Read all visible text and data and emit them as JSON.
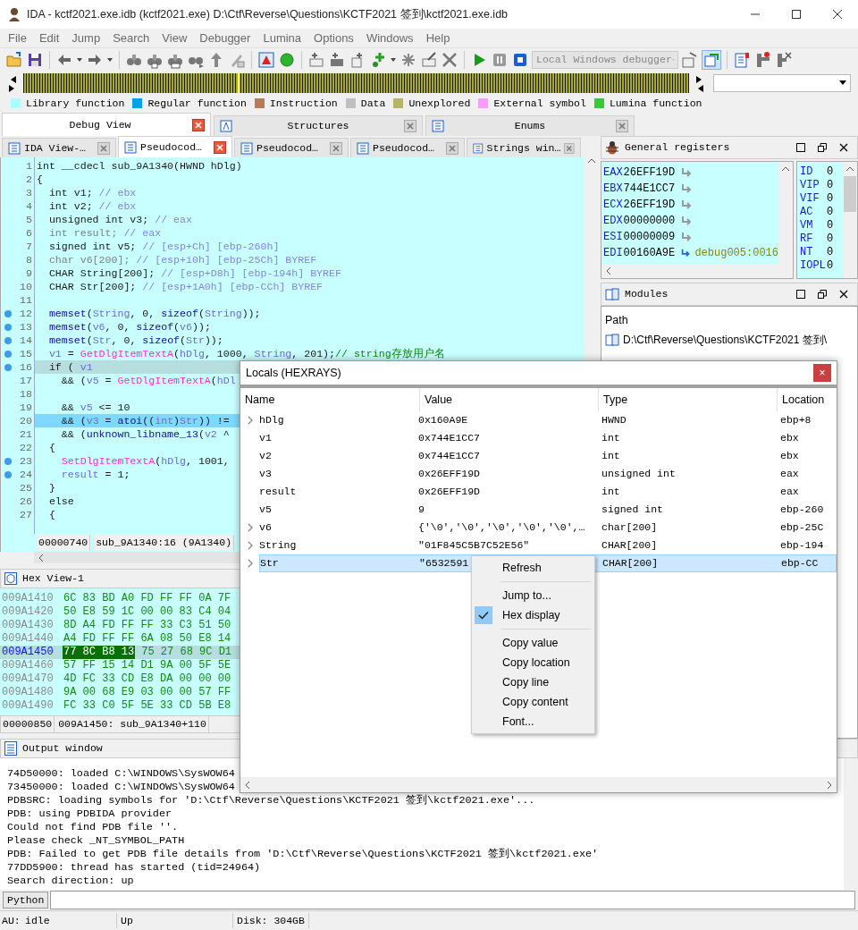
{
  "window": {
    "title": "IDA - kctf2021.exe.idb (kctf2021.exe) D:\\Ctf\\Reverse\\Questions\\KCTF2021 签到\\kctf2021.exe.idb"
  },
  "menu": [
    "File",
    "Edit",
    "Jump",
    "Search",
    "View",
    "Debugger",
    "Lumina",
    "Options",
    "Windows",
    "Help"
  ],
  "toolbar": {
    "debugger": "Local Windows debugger"
  },
  "legend": [
    {
      "label": "Library function",
      "color": "#aaffff"
    },
    {
      "label": "Regular function",
      "color": "#00a2e8"
    },
    {
      "label": "Instruction",
      "color": "#b97a57"
    },
    {
      "label": "Data",
      "color": "#c0c0c0"
    },
    {
      "label": "Unexplored",
      "color": "#b5b56a"
    },
    {
      "label": "External symbol",
      "color": "#ff99ff"
    },
    {
      "label": "Lumina function",
      "color": "#33cc33"
    }
  ],
  "top_tabs": [
    {
      "label": "Debug View",
      "selected": true
    },
    {
      "label": "Structures",
      "selected": false
    },
    {
      "label": "Enums",
      "selected": false
    }
  ],
  "view_tabs": [
    {
      "label": "IDA View-…",
      "selected": false
    },
    {
      "label": "Pseudocod…",
      "selected": true
    },
    {
      "label": "Pseudocod…",
      "selected": false
    },
    {
      "label": "Pseudocod…",
      "selected": false
    },
    {
      "label": "Strings win…",
      "selected": false
    }
  ],
  "pseudocode": {
    "lines": [
      {
        "n": "1",
        "dot": false,
        "current": false,
        "selected": false,
        "segments": [
          {
            "kind": "plain",
            "text": "int __cdecl sub_9A1340(HWND hDlg)"
          }
        ]
      },
      {
        "n": "2",
        "dot": false,
        "current": false,
        "selected": false,
        "segments": [
          {
            "kind": "plain",
            "text": "{"
          }
        ]
      },
      {
        "n": "3",
        "dot": false,
        "current": false,
        "selected": false,
        "segments": [
          {
            "kind": "plain",
            "text": "  int v1; "
          },
          {
            "kind": "comment",
            "text": "// ebx"
          }
        ]
      },
      {
        "n": "4",
        "dot": false,
        "current": false,
        "selected": false,
        "segments": [
          {
            "kind": "plain",
            "text": "  int v2; "
          },
          {
            "kind": "comment",
            "text": "// ebx"
          }
        ]
      },
      {
        "n": "5",
        "dot": false,
        "current": false,
        "selected": false,
        "segments": [
          {
            "kind": "plain",
            "text": "  unsigned int v3; "
          },
          {
            "kind": "comment",
            "text": "// eax"
          }
        ]
      },
      {
        "n": "6",
        "dot": false,
        "current": false,
        "selected": false,
        "segments": [
          {
            "kind": "dim",
            "text": "  int result; "
          },
          {
            "kind": "comment",
            "text": "// eax"
          }
        ]
      },
      {
        "n": "7",
        "dot": false,
        "current": false,
        "selected": false,
        "segments": [
          {
            "kind": "plain",
            "text": "  signed int v5; "
          },
          {
            "kind": "comment",
            "text": "// [esp+Ch] [ebp-260h]"
          }
        ]
      },
      {
        "n": "8",
        "dot": false,
        "current": false,
        "selected": false,
        "segments": [
          {
            "kind": "dim",
            "text": "  char v6[200]; "
          },
          {
            "kind": "comment",
            "text": "// [esp+10h] [ebp-25Ch] BYREF"
          }
        ]
      },
      {
        "n": "9",
        "dot": false,
        "current": false,
        "selected": false,
        "segments": [
          {
            "kind": "plain",
            "text": "  CHAR String[200]; "
          },
          {
            "kind": "comment",
            "text": "// [esp+D8h] [ebp-194h] BYREF"
          }
        ]
      },
      {
        "n": "10",
        "dot": false,
        "current": false,
        "selected": false,
        "segments": [
          {
            "kind": "plain",
            "text": "  CHAR Str[200]; "
          },
          {
            "kind": "comment",
            "text": "// [esp+1A0h] [ebp-CCh] BYREF"
          }
        ]
      },
      {
        "n": "11",
        "dot": false,
        "current": false,
        "selected": false
      },
      {
        "n": "12",
        "dot": true,
        "current": false,
        "selected": false,
        "segments": [
          {
            "kind": "lib",
            "text": "  memset"
          },
          {
            "kind": "plain",
            "text": "("
          },
          {
            "kind": "var",
            "text": "String"
          },
          {
            "kind": "plain",
            "text": ", 0, "
          },
          {
            "kind": "lib",
            "text": "sizeof"
          },
          {
            "kind": "plain",
            "text": "("
          },
          {
            "kind": "var",
            "text": "String"
          },
          {
            "kind": "plain",
            "text": "));"
          }
        ]
      },
      {
        "n": "13",
        "dot": true,
        "current": false,
        "selected": false,
        "segments": [
          {
            "kind": "lib",
            "text": "  memset"
          },
          {
            "kind": "plain",
            "text": "("
          },
          {
            "kind": "var",
            "text": "v6"
          },
          {
            "kind": "plain",
            "text": ", 0, "
          },
          {
            "kind": "lib",
            "text": "sizeof"
          },
          {
            "kind": "plain",
            "text": "("
          },
          {
            "kind": "var",
            "text": "v6"
          },
          {
            "kind": "plain",
            "text": "));"
          }
        ]
      },
      {
        "n": "14",
        "dot": true,
        "current": false,
        "selected": false,
        "segments": [
          {
            "kind": "lib",
            "text": "  memset"
          },
          {
            "kind": "plain",
            "text": "("
          },
          {
            "kind": "var",
            "text": "Str"
          },
          {
            "kind": "plain",
            "text": ", 0, "
          },
          {
            "kind": "lib",
            "text": "sizeof"
          },
          {
            "kind": "plain",
            "text": "("
          },
          {
            "kind": "var",
            "text": "Str"
          },
          {
            "kind": "plain",
            "text": "));"
          }
        ]
      },
      {
        "n": "15",
        "dot": true,
        "current": false,
        "selected": false,
        "segments": [
          {
            "kind": "var",
            "text": "  v1"
          },
          {
            "kind": "plain",
            "text": " = "
          },
          {
            "kind": "func",
            "text": "GetDlgItemTextA"
          },
          {
            "kind": "plain",
            "text": "("
          },
          {
            "kind": "var",
            "text": "hDlg"
          },
          {
            "kind": "plain",
            "text": ", 1000, "
          },
          {
            "kind": "var",
            "text": "String"
          },
          {
            "kind": "plain",
            "text": ", 201);"
          },
          {
            "kind": "note",
            "text": "// string存放用户名"
          }
        ]
      },
      {
        "n": "16",
        "dot": true,
        "current": true,
        "selected": false,
        "segments": [
          {
            "kind": "plain",
            "text": "  if ( "
          },
          {
            "kind": "var",
            "text": "v1"
          }
        ]
      },
      {
        "n": "17",
        "dot": false,
        "current": false,
        "selected": false,
        "segments": [
          {
            "kind": "plain",
            "text": "    && ("
          },
          {
            "kind": "var",
            "text": "v5"
          },
          {
            "kind": "plain",
            "text": " = "
          },
          {
            "kind": "func",
            "text": "GetDlgItemTextA"
          },
          {
            "kind": "plain",
            "text": "("
          },
          {
            "kind": "var",
            "text": "hDl"
          }
        ]
      },
      {
        "n": "18",
        "dot": false,
        "current": false,
        "selected": false
      },
      {
        "n": "19",
        "dot": false,
        "current": false,
        "selected": false,
        "segments": [
          {
            "kind": "plain",
            "text": "    && "
          },
          {
            "kind": "var",
            "text": "v5"
          },
          {
            "kind": "plain",
            "text": " <= 10"
          }
        ]
      },
      {
        "n": "20",
        "dot": false,
        "current": false,
        "selected": true,
        "segments": [
          {
            "kind": "plain",
            "text": "    && ("
          },
          {
            "kind": "var",
            "text": "v3"
          },
          {
            "kind": "plain",
            "text": " = "
          },
          {
            "kind": "lib",
            "text": "atoi"
          },
          {
            "kind": "plain",
            "text": "(("
          },
          {
            "kind": "var",
            "text": "int"
          },
          {
            "kind": "plain",
            "text": ")"
          },
          {
            "kind": "var",
            "text": "Str"
          },
          {
            "kind": "plain",
            "text": ")) !="
          }
        ]
      },
      {
        "n": "21",
        "dot": false,
        "current": false,
        "selected": false,
        "segments": [
          {
            "kind": "plain",
            "text": "    && ("
          },
          {
            "kind": "lib",
            "text": "unknown_libname_13"
          },
          {
            "kind": "plain",
            "text": "("
          },
          {
            "kind": "var",
            "text": "v2"
          },
          {
            "kind": "plain",
            "text": " ^"
          }
        ]
      },
      {
        "n": "22",
        "dot": false,
        "current": false,
        "selected": false,
        "segments": [
          {
            "kind": "plain",
            "text": "  {"
          }
        ]
      },
      {
        "n": "23",
        "dot": true,
        "current": false,
        "selected": false,
        "segments": [
          {
            "kind": "func",
            "text": "    SetDlgItemTextA"
          },
          {
            "kind": "plain",
            "text": "("
          },
          {
            "kind": "var",
            "text": "hDlg"
          },
          {
            "kind": "plain",
            "text": ", 1001,"
          }
        ]
      },
      {
        "n": "24",
        "dot": true,
        "current": false,
        "selected": false,
        "segments": [
          {
            "kind": "var",
            "text": "    result"
          },
          {
            "kind": "plain",
            "text": " = 1;"
          }
        ]
      },
      {
        "n": "25",
        "dot": false,
        "current": false,
        "selected": false,
        "segments": [
          {
            "kind": "plain",
            "text": "  }"
          }
        ]
      },
      {
        "n": "26",
        "dot": false,
        "current": false,
        "selected": false,
        "segments": [
          {
            "kind": "plain",
            "text": "  else"
          }
        ]
      },
      {
        "n": "27",
        "dot": false,
        "current": false,
        "selected": false,
        "segments": [
          {
            "kind": "plain",
            "text": "  {"
          }
        ]
      }
    ],
    "status": [
      "00000740",
      "sub_9A1340:16 (9A1340)"
    ]
  },
  "registers": {
    "title": "General registers",
    "items": [
      {
        "name": "EAX",
        "value": "26EFF19D",
        "pointer": false
      },
      {
        "name": "EBX",
        "value": "744E1CC7",
        "pointer": false
      },
      {
        "name": "ECX",
        "value": "26EFF19D",
        "pointer": false
      },
      {
        "name": "EDX",
        "value": "00000000",
        "pointer": false
      },
      {
        "name": "ESI",
        "value": "00000009",
        "pointer": false
      },
      {
        "name": "EDI",
        "value": "00160A9E",
        "pointer": true,
        "target": "debug005:0016"
      }
    ],
    "flags": [
      {
        "name": "ID",
        "value": "0"
      },
      {
        "name": "VIP",
        "value": "0"
      },
      {
        "name": "VIF",
        "value": "0"
      },
      {
        "name": "AC",
        "value": "0"
      },
      {
        "name": "VM",
        "value": "0"
      },
      {
        "name": "RF",
        "value": "0"
      },
      {
        "name": "NT",
        "value": "0"
      },
      {
        "name": "IOPL",
        "value": "0"
      }
    ]
  },
  "modules": {
    "title": "Modules",
    "column": "Path",
    "rows": [
      "D:\\Ctf\\Reverse\\Questions\\KCTF2021 签到\\"
    ]
  },
  "hex_view": {
    "title": "Hex View-1",
    "rows": [
      {
        "addr": "009A1410",
        "current": false,
        "bytes": [
          "6C",
          "83",
          "BD",
          "A0",
          "FD",
          "FF",
          "FF",
          "0A",
          "7F"
        ]
      },
      {
        "addr": "009A1420",
        "current": false,
        "bytes": [
          "50",
          "E8",
          "59",
          "1C",
          "00",
          "00",
          "83",
          "C4",
          "04"
        ]
      },
      {
        "addr": "009A1430",
        "current": false,
        "bytes": [
          "8D",
          "A4",
          "FD",
          "FF",
          "FF",
          "33",
          "C3",
          "51",
          "50"
        ]
      },
      {
        "addr": "009A1440",
        "current": false,
        "bytes": [
          "A4",
          "FD",
          "FF",
          "FF",
          "6A",
          "08",
          "50",
          "E8",
          "14"
        ]
      },
      {
        "addr": "009A1450",
        "current": true,
        "selected_bytes": [
          "77",
          "8C",
          "B8",
          "13"
        ],
        "bytes": [
          "75",
          "27",
          "68",
          "9C",
          "D1"
        ]
      },
      {
        "addr": "009A1460",
        "current": false,
        "bytes": [
          "57",
          "FF",
          "15",
          "14",
          "D1",
          "9A",
          "00",
          "5F",
          "5E"
        ]
      },
      {
        "addr": "009A1470",
        "current": false,
        "bytes": [
          "4D",
          "FC",
          "33",
          "CD",
          "E8",
          "DA",
          "00",
          "00",
          "00"
        ]
      },
      {
        "addr": "009A1480",
        "current": false,
        "bytes": [
          "9A",
          "00",
          "68",
          "E9",
          "03",
          "00",
          "00",
          "57",
          "FF"
        ]
      },
      {
        "addr": "009A1490",
        "current": false,
        "bytes": [
          "FC",
          "33",
          "C0",
          "5F",
          "5E",
          "33",
          "CD",
          "5B",
          "E8"
        ]
      }
    ],
    "status": [
      "00000850",
      "009A1450: sub_9A1340+110"
    ]
  },
  "output": {
    "title": "Output window",
    "lines": [
      "74D50000: loaded C:\\WINDOWS\\SysWOW64",
      "73450000: loaded C:\\WINDOWS\\SysWOW64",
      "PDBSRC: loading symbols for 'D:\\Ctf\\Reverse\\Questions\\KCTF2021 签到\\kctf2021.exe'...",
      "PDB: using PDBIDA provider",
      "Could not find PDB file ''.",
      "Please check _NT_SYMBOL_PATH",
      "PDB: Failed to get PDB file details from 'D:\\Ctf\\Reverse\\Questions\\KCTF2021 签到\\kctf2021.exe'",
      "77DD5900: thread has started (tid=24964)",
      "Search direction: up"
    ],
    "cli": "Python"
  },
  "status_bar": [
    "AU:",
    "idle",
    "Up",
    "Disk: 304GB"
  ],
  "locals": {
    "title": "Locals (HEXRAYS)",
    "close": "×",
    "columns": [
      "Name",
      "Value",
      "Type",
      "Location"
    ],
    "rows": [
      {
        "name": "hDlg",
        "value": "0x160A9E",
        "type": "HWND",
        "location": "ebp+8",
        "expandable": true,
        "selected": false
      },
      {
        "name": "v1",
        "value": "0x744E1CC7",
        "type": "int",
        "location": "ebx",
        "expandable": false,
        "selected": false
      },
      {
        "name": "v2",
        "value": "0x744E1CC7",
        "type": "int",
        "location": "ebx",
        "expandable": false,
        "selected": false
      },
      {
        "name": "v3",
        "value": "0x26EFF19D",
        "type": "unsigned int",
        "location": "eax",
        "expandable": false,
        "selected": false
      },
      {
        "name": "result",
        "value": "0x26EFF19D",
        "type": "int",
        "location": "eax",
        "expandable": false,
        "selected": false
      },
      {
        "name": "v5",
        "value": "9",
        "type": "signed int",
        "location": "ebp-260",
        "expandable": false,
        "selected": false
      },
      {
        "name": "v6",
        "value": "{'\\0','\\0','\\0','\\0','\\0',…",
        "type": "char[200]",
        "location": "ebp-25C",
        "expandable": true,
        "selected": false
      },
      {
        "name": "String",
        "value": "\"01F845C5B7C52E56\"",
        "type": "CHAR[200]",
        "location": "ebp-194",
        "expandable": true,
        "selected": false
      },
      {
        "name": "Str",
        "value": "\"6532591",
        "type": "CHAR[200]",
        "location": "ebp-CC",
        "expandable": true,
        "selected": true
      }
    ]
  },
  "context_menu": [
    {
      "kind": "item",
      "label": "Refresh",
      "checked": false
    },
    {
      "kind": "separator"
    },
    {
      "kind": "item",
      "label": "Jump to...",
      "checked": false
    },
    {
      "kind": "item",
      "label": "Hex display",
      "checked": true
    },
    {
      "kind": "separator"
    },
    {
      "kind": "item",
      "label": "Copy value",
      "checked": false
    },
    {
      "kind": "item",
      "label": "Copy location",
      "checked": false
    },
    {
      "kind": "item",
      "label": "Copy line",
      "checked": false
    },
    {
      "kind": "item",
      "label": "Copy content",
      "checked": false
    },
    {
      "kind": "item",
      "label": "Font...",
      "checked": false
    }
  ]
}
